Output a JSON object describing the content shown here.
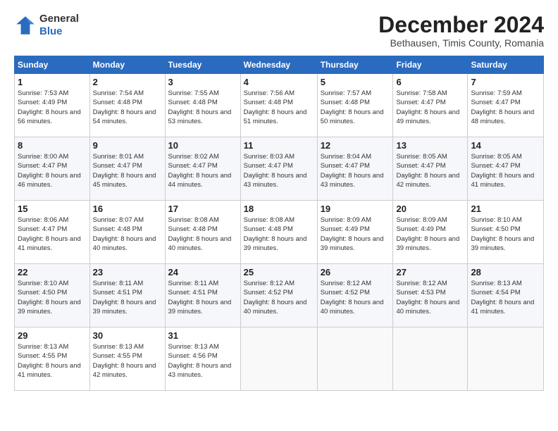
{
  "header": {
    "logo": {
      "general": "General",
      "blue": "Blue"
    },
    "title": "December 2024",
    "location": "Bethausen, Timis County, Romania"
  },
  "calendar": {
    "days_of_week": [
      "Sunday",
      "Monday",
      "Tuesday",
      "Wednesday",
      "Thursday",
      "Friday",
      "Saturday"
    ],
    "weeks": [
      [
        null,
        null,
        null,
        null,
        null,
        null,
        null
      ]
    ]
  },
  "cells": {
    "w1": [
      {
        "num": "1",
        "sunrise": "7:53 AM",
        "sunset": "4:49 PM",
        "daylight": "8 hours and 56 minutes."
      },
      {
        "num": "2",
        "sunrise": "7:54 AM",
        "sunset": "4:48 PM",
        "daylight": "8 hours and 54 minutes."
      },
      {
        "num": "3",
        "sunrise": "7:55 AM",
        "sunset": "4:48 PM",
        "daylight": "8 hours and 53 minutes."
      },
      {
        "num": "4",
        "sunrise": "7:56 AM",
        "sunset": "4:48 PM",
        "daylight": "8 hours and 51 minutes."
      },
      {
        "num": "5",
        "sunrise": "7:57 AM",
        "sunset": "4:48 PM",
        "daylight": "8 hours and 50 minutes."
      },
      {
        "num": "6",
        "sunrise": "7:58 AM",
        "sunset": "4:47 PM",
        "daylight": "8 hours and 49 minutes."
      },
      {
        "num": "7",
        "sunrise": "7:59 AM",
        "sunset": "4:47 PM",
        "daylight": "8 hours and 48 minutes."
      }
    ],
    "w2": [
      {
        "num": "8",
        "sunrise": "8:00 AM",
        "sunset": "4:47 PM",
        "daylight": "8 hours and 46 minutes."
      },
      {
        "num": "9",
        "sunrise": "8:01 AM",
        "sunset": "4:47 PM",
        "daylight": "8 hours and 45 minutes."
      },
      {
        "num": "10",
        "sunrise": "8:02 AM",
        "sunset": "4:47 PM",
        "daylight": "8 hours and 44 minutes."
      },
      {
        "num": "11",
        "sunrise": "8:03 AM",
        "sunset": "4:47 PM",
        "daylight": "8 hours and 43 minutes."
      },
      {
        "num": "12",
        "sunrise": "8:04 AM",
        "sunset": "4:47 PM",
        "daylight": "8 hours and 43 minutes."
      },
      {
        "num": "13",
        "sunrise": "8:05 AM",
        "sunset": "4:47 PM",
        "daylight": "8 hours and 42 minutes."
      },
      {
        "num": "14",
        "sunrise": "8:05 AM",
        "sunset": "4:47 PM",
        "daylight": "8 hours and 41 minutes."
      }
    ],
    "w3": [
      {
        "num": "15",
        "sunrise": "8:06 AM",
        "sunset": "4:47 PM",
        "daylight": "8 hours and 41 minutes."
      },
      {
        "num": "16",
        "sunrise": "8:07 AM",
        "sunset": "4:48 PM",
        "daylight": "8 hours and 40 minutes."
      },
      {
        "num": "17",
        "sunrise": "8:08 AM",
        "sunset": "4:48 PM",
        "daylight": "8 hours and 40 minutes."
      },
      {
        "num": "18",
        "sunrise": "8:08 AM",
        "sunset": "4:48 PM",
        "daylight": "8 hours and 39 minutes."
      },
      {
        "num": "19",
        "sunrise": "8:09 AM",
        "sunset": "4:49 PM",
        "daylight": "8 hours and 39 minutes."
      },
      {
        "num": "20",
        "sunrise": "8:09 AM",
        "sunset": "4:49 PM",
        "daylight": "8 hours and 39 minutes."
      },
      {
        "num": "21",
        "sunrise": "8:10 AM",
        "sunset": "4:50 PM",
        "daylight": "8 hours and 39 minutes."
      }
    ],
    "w4": [
      {
        "num": "22",
        "sunrise": "8:10 AM",
        "sunset": "4:50 PM",
        "daylight": "8 hours and 39 minutes."
      },
      {
        "num": "23",
        "sunrise": "8:11 AM",
        "sunset": "4:51 PM",
        "daylight": "8 hours and 39 minutes."
      },
      {
        "num": "24",
        "sunrise": "8:11 AM",
        "sunset": "4:51 PM",
        "daylight": "8 hours and 39 minutes."
      },
      {
        "num": "25",
        "sunrise": "8:12 AM",
        "sunset": "4:52 PM",
        "daylight": "8 hours and 40 minutes."
      },
      {
        "num": "26",
        "sunrise": "8:12 AM",
        "sunset": "4:52 PM",
        "daylight": "8 hours and 40 minutes."
      },
      {
        "num": "27",
        "sunrise": "8:12 AM",
        "sunset": "4:53 PM",
        "daylight": "8 hours and 40 minutes."
      },
      {
        "num": "28",
        "sunrise": "8:13 AM",
        "sunset": "4:54 PM",
        "daylight": "8 hours and 41 minutes."
      }
    ],
    "w5": [
      {
        "num": "29",
        "sunrise": "8:13 AM",
        "sunset": "4:55 PM",
        "daylight": "8 hours and 41 minutes."
      },
      {
        "num": "30",
        "sunrise": "8:13 AM",
        "sunset": "4:55 PM",
        "daylight": "8 hours and 42 minutes."
      },
      {
        "num": "31",
        "sunrise": "8:13 AM",
        "sunset": "4:56 PM",
        "daylight": "8 hours and 43 minutes."
      },
      null,
      null,
      null,
      null
    ]
  }
}
